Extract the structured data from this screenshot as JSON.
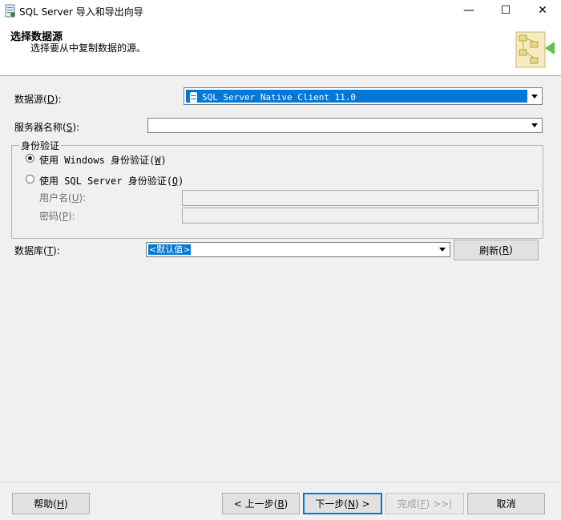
{
  "window": {
    "title": "SQL Server 导入和导出向导",
    "minimize_glyph": "—",
    "maximize_glyph": "☐",
    "close_glyph": "✕"
  },
  "header": {
    "title": "选择数据源",
    "subtitle": "选择要从中复制数据的源。"
  },
  "form": {
    "data_source_label": "数据源(",
    "data_source_key": "D",
    "data_source_label_end": "):",
    "data_source_value": "SQL Server Native Client 11.0",
    "server_label": "服务器名称(",
    "server_key": "S",
    "server_label_end": "):",
    "server_value": "",
    "auth_group": "身份验证",
    "windows_auth_label": "使用 Windows 身份验证(",
    "windows_auth_key": "W",
    "windows_auth_end": ")",
    "sql_auth_label": "使用 SQL Server 身份验证(",
    "sql_auth_key": "Q",
    "sql_auth_end": ")",
    "username_label": "用户名(",
    "username_key": "U",
    "username_end": "):",
    "password_label": "密码(",
    "password_key": "P",
    "password_end": "):",
    "database_label": "数据库(",
    "database_key": "T",
    "database_end": "):",
    "database_value": "<默认值>",
    "refresh_label": "刷新(",
    "refresh_key": "R",
    "refresh_end": ")"
  },
  "footer": {
    "help_label": "帮助(",
    "help_key": "H",
    "help_end": ")",
    "back_label": "< 上一步(",
    "back_key": "B",
    "back_end": ")",
    "next_label": "下一步(",
    "next_key": "N",
    "next_end": ") >",
    "finish_label": "完成(",
    "finish_key": "F",
    "finish_end": ") >>|",
    "cancel_label": "取消"
  },
  "colors": {
    "selection": "#0078d7",
    "dialog_bg": "#f0f0f0"
  }
}
